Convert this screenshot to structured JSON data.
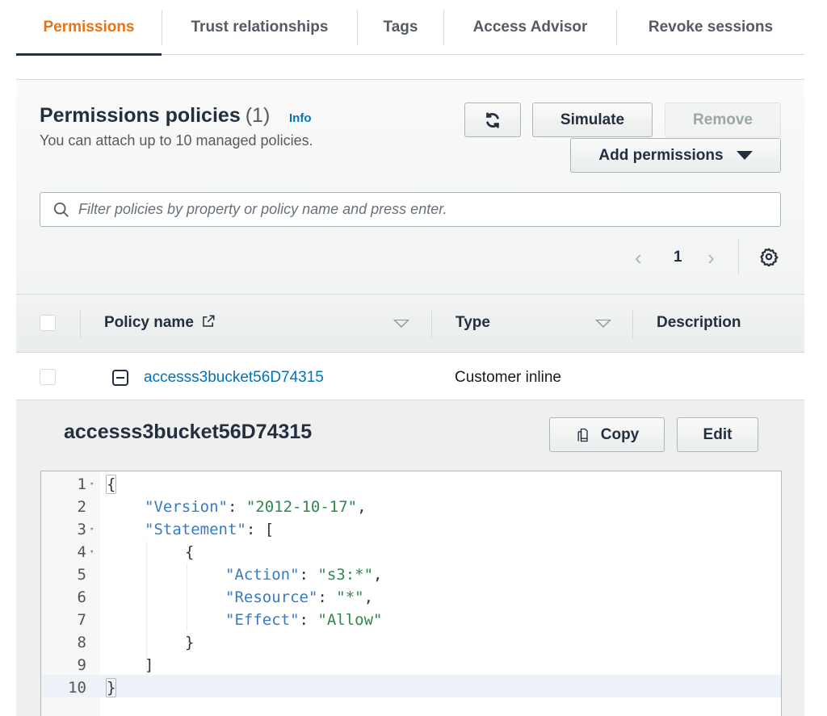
{
  "tabs": [
    {
      "label": "Permissions",
      "active": true
    },
    {
      "label": "Trust relationships",
      "active": false
    },
    {
      "label": "Tags",
      "active": false
    },
    {
      "label": "Access Advisor",
      "active": false
    },
    {
      "label": "Revoke sessions",
      "active": false
    }
  ],
  "permissions_panel": {
    "title": "Permissions policies",
    "count": "(1)",
    "info_link": "Info",
    "subtitle": "You can attach up to 10 managed policies.",
    "buttons": {
      "refresh_icon": "refresh-icon",
      "simulate": "Simulate",
      "remove": "Remove",
      "add_permissions": "Add permissions"
    },
    "search": {
      "placeholder": "Filter policies by property or policy name and press enter.",
      "value": ""
    },
    "pagination": {
      "prev": "‹",
      "current_page": "1",
      "next": "›"
    }
  },
  "table": {
    "columns": [
      {
        "label": "Policy name",
        "icon": "external-link-icon",
        "sortable": true
      },
      {
        "label": "Type",
        "sortable": true
      },
      {
        "label": "Description",
        "sortable": false
      }
    ],
    "rows": [
      {
        "policy_name": "accesss3bucket56D74315",
        "type": "Customer inline",
        "description": "",
        "expanded": true
      }
    ]
  },
  "policy_detail": {
    "title": "accesss3bucket56D74315",
    "copy_label": "Copy",
    "edit_label": "Edit",
    "editor": {
      "active_line": 10,
      "lines": [
        {
          "num": "1",
          "fold": true
        },
        {
          "num": "2",
          "fold": false
        },
        {
          "num": "3",
          "fold": true
        },
        {
          "num": "4",
          "fold": true
        },
        {
          "num": "5",
          "fold": false
        },
        {
          "num": "6",
          "fold": false
        },
        {
          "num": "7",
          "fold": false
        },
        {
          "num": "8",
          "fold": false
        },
        {
          "num": "9",
          "fold": false
        },
        {
          "num": "10",
          "fold": false
        }
      ],
      "tokens": {
        "open_brace": "{",
        "version_key": "\"Version\"",
        "version_val": "\"2012-10-17\"",
        "statement_key": "\"Statement\"",
        "open_bracket": "[",
        "inner_open": "{",
        "action_key": "\"Action\"",
        "action_val": "\"s3:*\"",
        "resource_key": "\"Resource\"",
        "resource_val": "\"*\"",
        "effect_key": "\"Effect\"",
        "effect_val": "\"Allow\"",
        "inner_close": "}",
        "close_bracket": "]",
        "close_brace": "}"
      }
    }
  }
}
